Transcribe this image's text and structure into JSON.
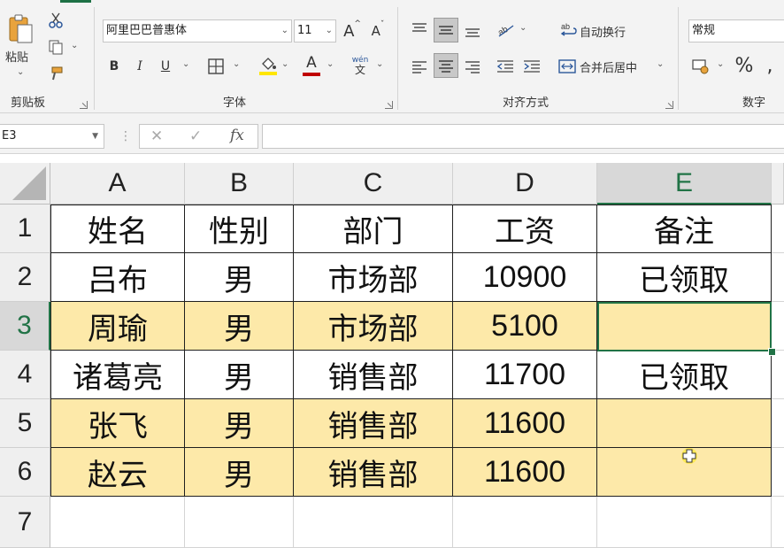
{
  "ribbon": {
    "clipboard": {
      "paste_label": "粘贴",
      "group_label": "剪贴板"
    },
    "font": {
      "family": "阿里巴巴普惠体",
      "size": "11",
      "grow_label": "A",
      "shrink_label": "A",
      "bold": "B",
      "italic": "I",
      "underline": "U",
      "font_color_letter": "A",
      "phonetic_top": "wén",
      "phonetic_bottom": "文",
      "group_label": "字体"
    },
    "alignment": {
      "wrap_text": "自动换行",
      "merge_center": "合并后居中",
      "group_label": "对齐方式"
    },
    "number": {
      "format": "常规",
      "percent": "%",
      "group_label": "数字"
    }
  },
  "formula_bar": {
    "name_box": "E3",
    "cancel": "✕",
    "enter": "✓",
    "fx": "fx",
    "content": ""
  },
  "sheet": {
    "columns": [
      "A",
      "B",
      "C",
      "D",
      "E"
    ],
    "rows": [
      "1",
      "2",
      "3",
      "4",
      "5",
      "6",
      "7"
    ],
    "active_column": "E",
    "active_row": "3",
    "highlight_color": "#fde9a9",
    "table": [
      [
        "姓名",
        "性别",
        "部门",
        "工资",
        "备注"
      ],
      [
        "吕布",
        "男",
        "市场部",
        "10900",
        "已领取"
      ],
      [
        "周瑜",
        "男",
        "市场部",
        "5100",
        ""
      ],
      [
        "诸葛亮",
        "男",
        "销售部",
        "11700",
        "已领取"
      ],
      [
        "张飞",
        "男",
        "销售部",
        "11600",
        ""
      ],
      [
        "赵云",
        "男",
        "销售部",
        "11600",
        ""
      ],
      [
        "",
        "",
        "",
        "",
        ""
      ]
    ],
    "highlighted_rows": [
      3,
      5,
      6
    ]
  }
}
